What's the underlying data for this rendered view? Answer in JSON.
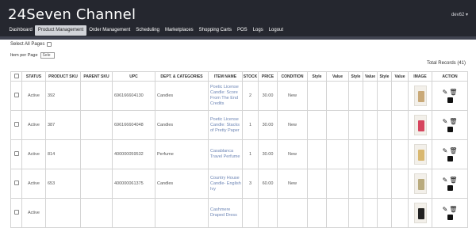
{
  "app": {
    "title": "24Seven Channel",
    "user": "dev62 ▾"
  },
  "nav": [
    "Dashboard",
    "Product Management",
    "Order Management",
    "Scheduling",
    "Marketplaces",
    "Shopping Carts",
    "POS",
    "Logs",
    "Logout"
  ],
  "active_nav": "Product Management",
  "controls": {
    "select_all_label": "Select All Pages",
    "per_page_label": "Item per Page",
    "per_page_value": "Sele"
  },
  "total_records": "Total Records (41)",
  "table": {
    "headers": [
      "",
      "STATUS",
      "PRODUCT SKU",
      "PARENT SKU",
      "UPC",
      "DEPT. & CATEGORIES",
      "ITEM NAME",
      "STOCK",
      "PRICE",
      "CONDITION",
      "Style",
      "Value",
      "Style",
      "Value",
      "Style",
      "Value",
      "IMAGE",
      "ACTION"
    ],
    "rows": [
      {
        "status": "Active",
        "sku": "392",
        "parent": "",
        "upc": "696166604130",
        "dept": "Candles",
        "name": "Poetic License Candle: Score From The End Credits",
        "stock": "2",
        "price": "30.00",
        "condition": "New",
        "img": "#c9a978"
      },
      {
        "status": "Active",
        "sku": "387",
        "parent": "",
        "upc": "696166604048",
        "dept": "Candles",
        "name": "Poetic License Candle: Stacks of Pretty Paper",
        "stock": "1",
        "price": "30.00",
        "condition": "New",
        "img": "#d6455e"
      },
      {
        "status": "Active",
        "sku": "814",
        "parent": "",
        "upc": "400000059532",
        "dept": "Perfume",
        "name": "Casablanca Travel Perfume",
        "stock": "1",
        "price": "30.00",
        "condition": "New",
        "img": "#d9b870"
      },
      {
        "status": "Active",
        "sku": "653",
        "parent": "",
        "upc": "400000061375",
        "dept": "Candles",
        "name": "Country House Candle- English Ivy",
        "stock": "3",
        "price": "60.00",
        "condition": "New",
        "img": "#b9ab7e"
      },
      {
        "status": "Active",
        "sku": "",
        "parent": "",
        "upc": "",
        "dept": "",
        "name": "Cashmere Draped Dress",
        "stock": "",
        "price": "",
        "condition": "",
        "img": "#222222"
      }
    ]
  },
  "icons": {
    "edit": "edit-icon",
    "delete": "trash-icon",
    "archive": "archive-icon"
  }
}
